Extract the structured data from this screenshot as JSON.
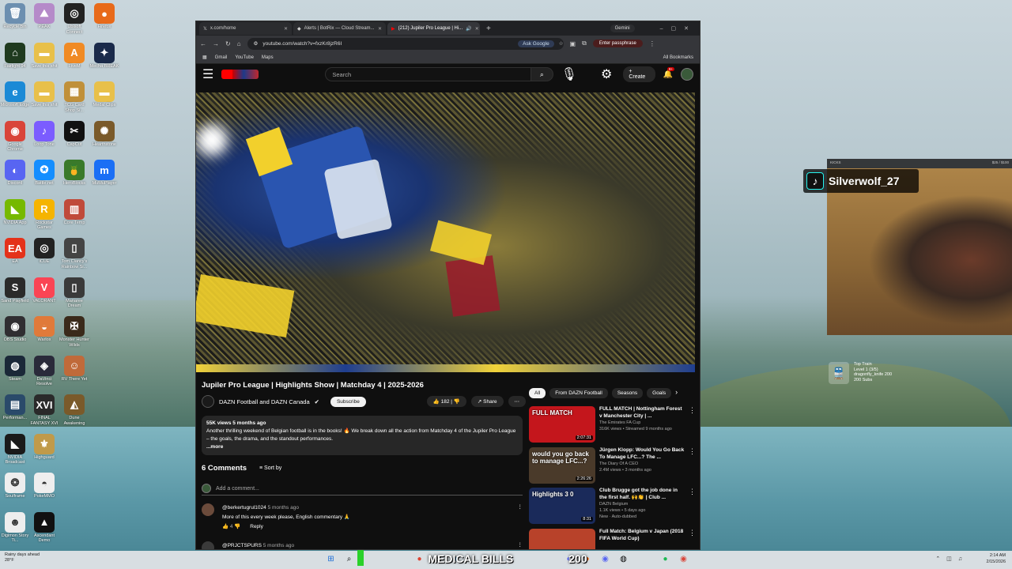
{
  "desktop": {
    "icons": [
      {
        "label": "Recycle Bin",
        "color": "#6c8fb0",
        "glyph": "🗑"
      },
      {
        "label": "PEAK",
        "color": "#b58ac9",
        "glyph": "⛰"
      },
      {
        "label": "Ubisoft Connect",
        "color": "#222",
        "glyph": "◎"
      },
      {
        "label": "Firefox",
        "color": "#e86a1a",
        "glyph": "●"
      },
      {
        "label": "Fairlight 94",
        "color": "#1f3a1f",
        "glyph": "⌂"
      },
      {
        "label": "Save this shit",
        "color": "#e8c04a",
        "glyph": "▬"
      },
      {
        "label": "FiveM",
        "color": "#f08a24",
        "glyph": "A"
      },
      {
        "label": "Mecha BREAK",
        "color": "#1a2a4a",
        "glyph": "✦"
      },
      {
        "label": "Microsoft Edge",
        "color": "#1b8ad6",
        "glyph": "e"
      },
      {
        "label": "Save this shit",
        "color": "#e8c04a",
        "glyph": "▬"
      },
      {
        "label": "TCG Card Shop Si...",
        "color": "#c0903a",
        "glyph": "▦"
      },
      {
        "label": "Medal Clips",
        "color": "#e8c04a",
        "glyph": "▬"
      },
      {
        "label": "Google Chrome",
        "color": "#d9453a",
        "glyph": "◉"
      },
      {
        "label": "Loop Tone",
        "color": "#7b5cff",
        "glyph": "♪"
      },
      {
        "label": "CapCut",
        "color": "#111",
        "glyph": "✂"
      },
      {
        "label": "Hearthstone",
        "color": "#7a5a2a",
        "glyph": "✺"
      },
      {
        "label": "Discord",
        "color": "#5865f2",
        "glyph": "◐"
      },
      {
        "label": "Battle.net",
        "color": "#148eff",
        "glyph": "✪"
      },
      {
        "label": "HeroBlocks",
        "color": "#3a7a2a",
        "glyph": "🍍"
      },
      {
        "label": "MuMuPlayer",
        "color": "#1b6ff5",
        "glyph": "m"
      },
      {
        "label": "NVIDIA App",
        "color": "#76b900",
        "glyph": "◣"
      },
      {
        "label": "Rockstar Games",
        "color": "#f5b400",
        "glyph": "R"
      },
      {
        "label": "Core Temp",
        "color": "#c04a3a",
        "glyph": "▥"
      },
      {
        "label": "",
        "color": "transparent",
        "glyph": ""
      },
      {
        "label": "EA",
        "color": "#e4321a",
        "glyph": "EA"
      },
      {
        "label": "iCUE",
        "color": "#222",
        "glyph": "◎"
      },
      {
        "label": "Tom Clancy's Rainbow Si...",
        "color": "#444",
        "glyph": "▯"
      },
      {
        "label": "",
        "color": "transparent",
        "glyph": ""
      },
      {
        "label": "Sand Playfield",
        "color": "#2a2a2a",
        "glyph": "S"
      },
      {
        "label": "VALORANT",
        "color": "#fa4454",
        "glyph": "V"
      },
      {
        "label": "Manaree Dream",
        "color": "#3a3a3a",
        "glyph": "▯"
      },
      {
        "label": "",
        "color": "transparent",
        "glyph": ""
      },
      {
        "label": "OBS Studio",
        "color": "#302e31",
        "glyph": "◉"
      },
      {
        "label": "Warlox",
        "color": "#e07a3a",
        "glyph": "◒"
      },
      {
        "label": "Monster Hunter Wilds",
        "color": "#3a2a1a",
        "glyph": "✠"
      },
      {
        "label": "",
        "color": "transparent",
        "glyph": ""
      },
      {
        "label": "Steam",
        "color": "#1b2838",
        "glyph": "◍"
      },
      {
        "label": "DaVinci Resolve",
        "color": "#2a2a3a",
        "glyph": "◈"
      },
      {
        "label": "RV There Yet",
        "color": "#c06a3a",
        "glyph": "☺"
      },
      {
        "label": "",
        "color": "transparent",
        "glyph": ""
      },
      {
        "label": "Performan...",
        "color": "#2a4a6a",
        "glyph": "▤"
      },
      {
        "label": "FINAL FANTASY XVI",
        "color": "#2a2a2a",
        "glyph": "XVI"
      },
      {
        "label": "Dune Awakening",
        "color": "#7a5a2a",
        "glyph": "◭"
      },
      {
        "label": "",
        "color": "transparent",
        "glyph": ""
      },
      {
        "label": "NVIDIA Broadcast",
        "color": "#1a1a1a",
        "glyph": "◣"
      },
      {
        "label": "Highguard",
        "color": "#c09a4a",
        "glyph": "⚜"
      },
      {
        "label": "",
        "color": "transparent",
        "glyph": ""
      },
      {
        "label": "",
        "color": "transparent",
        "glyph": ""
      },
      {
        "label": "Soulframe",
        "color": "#eee",
        "glyph": "❂"
      },
      {
        "label": "PokeMMO",
        "color": "#eee",
        "glyph": "◓"
      },
      {
        "label": "",
        "color": "transparent",
        "glyph": ""
      },
      {
        "label": "",
        "color": "transparent",
        "glyph": ""
      },
      {
        "label": "Digimon Story Ti...",
        "color": "#eee",
        "glyph": "☻"
      },
      {
        "label": "Ascendant Demo",
        "color": "#111",
        "glyph": "▲"
      }
    ]
  },
  "browser": {
    "tabs": [
      {
        "title": "x.com/home",
        "active": false
      },
      {
        "title": "Alerts | BotRix — Cloud Stream...",
        "active": false
      },
      {
        "title": "(212) Jupiler Pro League | Hi...",
        "active": true
      }
    ],
    "gemini_label": "Gemini",
    "url": "youtube.com/watch?v=fxzKr8jzR6I",
    "ask_google": "Ask Google",
    "passphrase": "Enter passphrase",
    "bookmarks": [
      "Gmail",
      "YouTube",
      "Maps"
    ],
    "all_bookmarks": "All Bookmarks"
  },
  "youtube": {
    "search_placeholder": "Search",
    "create_label": "Create",
    "notif_count": "9+",
    "video_title": "Jupiler Pro League | Highlights Show | Matchday 4 | 2025-2026",
    "channel": "DAZN Football and DAZN Canada",
    "subscribe": "Subscribe",
    "likes": "182",
    "share": "Share",
    "views_line": "55K views  5 months ago",
    "description": "Another thrilling weekend of Belgian football is in the books! 🔥 We break down all the action from Matchday 4 of the Jupiler Pro League – the goals, the drama, and the standout performances.",
    "more": "...more",
    "comments_count": "6 Comments",
    "sort_by": "Sort by",
    "add_comment": "Add a comment...",
    "comments": [
      {
        "user": "@berkertugrul1024",
        "time": "5 months ago",
        "text": "More of this every week please, English commentary 🙏",
        "likes": "4",
        "reply": "Reply"
      },
      {
        "user": "@PRJCTSPURS",
        "time": "5 months ago",
        "text": "",
        "likes": "",
        "reply": ""
      }
    ],
    "chips": [
      "All",
      "From DAZN Football",
      "Seasons",
      "Goals"
    ],
    "recommended": [
      {
        "title": "FULL MATCH | Nottingham Forest v Manchester City | ...",
        "channel": "The Emirates FA Cup",
        "meta": "316K views • Streamed 9 months ago",
        "duration": "2:07:31",
        "thumb_text": "FULL MATCH",
        "thumb_color": "#c4161c",
        "badge": ""
      },
      {
        "title": "Jürgen Klopp: Would You Go Back To Manage LFC...? The ...",
        "channel": "The Diary Of A CEO",
        "meta": "2.4M views • 3 months ago",
        "duration": "2:26:26",
        "thumb_text": "would you go back to manage LFC...?",
        "thumb_color": "#4a3a2a",
        "badge": ""
      },
      {
        "title": "Club Brugge got the job done in the first half. 🙌👏 | Club ...",
        "channel": "DAZN Belgium",
        "meta": "1.1K views • 5 days ago",
        "duration": "8:31",
        "thumb_text": "Highlights 3 0",
        "thumb_color": "#1a2a5a",
        "badge": "New · Auto-dubbed"
      },
      {
        "title": "Full Match: Belgium v Japan (2018 FIFA World Cup)",
        "channel": "",
        "meta": "",
        "duration": "",
        "thumb_text": "",
        "thumb_color": "#b8422a",
        "badge": ""
      }
    ]
  },
  "overlay": {
    "tiktok_user": "Silverwolf_27",
    "cam_left": "KICKS",
    "cam_right": "$25 / $100",
    "train_title": "Top Train",
    "train_level": "Level 1 (3/5)",
    "train_user": "dragonfly_knife 200",
    "train_subs": "200 Subs"
  },
  "stream_banner": {
    "left_text": "MEDICAL BILLS",
    "right_text": "200"
  },
  "taskbar": {
    "weather_line1": "Rainy days ahead",
    "weather_line2": "28°F",
    "time": "2:14 AM",
    "date": "2/15/2026"
  }
}
